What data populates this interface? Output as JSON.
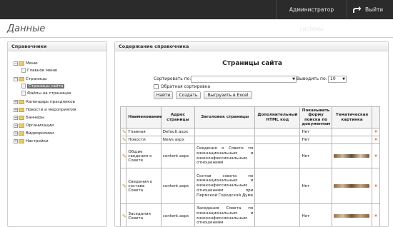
{
  "header": {
    "user_label": "Администратор системы",
    "logout_label": "Выйти"
  },
  "page": {
    "title": "Данные"
  },
  "left_panel": {
    "title": "Справочники",
    "tree": [
      {
        "label": "Меню",
        "expander": "−",
        "icon": "folder-icon",
        "level": 0
      },
      {
        "label": "Главное меню",
        "expander": "",
        "icon": "page-icon",
        "level": 1
      },
      {
        "label": "Страницы",
        "expander": "−",
        "icon": "folder-icon",
        "level": 0
      },
      {
        "label": "Страницы сайта",
        "expander": "",
        "icon": "page-icon",
        "level": 1,
        "selected": true
      },
      {
        "label": "Файлы на страницах",
        "expander": "",
        "icon": "page-icon",
        "level": 1
      },
      {
        "label": "Календарь праздников",
        "expander": "+",
        "icon": "folder-icon",
        "level": 0
      },
      {
        "label": "Новости и мероприятия",
        "expander": "+",
        "icon": "folder-icon",
        "level": 0
      },
      {
        "label": "Баннеры",
        "expander": "+",
        "icon": "folder-icon",
        "level": 0
      },
      {
        "label": "Организации",
        "expander": "+",
        "icon": "folder-icon",
        "level": 0
      },
      {
        "label": "Видеоролики",
        "expander": "+",
        "icon": "folder-icon",
        "level": 0
      },
      {
        "label": "Настройки",
        "expander": "+",
        "icon": "folder-icon",
        "level": 0
      }
    ]
  },
  "right_panel": {
    "title": "Содержание справочника",
    "content_title": "Страницы сайта",
    "sort_label": "Сортировать по:",
    "sort_value": "",
    "show_label": "Выводить по:",
    "show_value": "10",
    "reverse_sort_label": "Обратная сортировка",
    "buttons": {
      "find": "Найти",
      "create": "Создать",
      "export": "Выгрузить в Excel"
    },
    "columns": [
      "",
      "Наименование",
      "Адрес страницы",
      "Заголовок страницы",
      "Дополнительный HTML код",
      "Показывать форму поиска по документам",
      "Тематическая картинка",
      ""
    ],
    "rows": [
      {
        "name": "Главная",
        "address": "Default.aspx",
        "heading": "",
        "html": "",
        "search": "Нет",
        "picture": ""
      },
      {
        "name": "Новости",
        "address": "News.aspx",
        "heading": "",
        "html": "",
        "search": "Нет",
        "picture": ""
      },
      {
        "name": "Общие сведения о Совете",
        "address": "content.aspx",
        "heading": "Сведения о Совете по межнациональным и межконфессиональным отношениям",
        "html": "",
        "search": "Нет",
        "picture": "thumbnail"
      },
      {
        "name": "Сведения о составе Совета",
        "address": "content.aspx",
        "heading": "Состав совета по межнациональным и межконфессиональным отношениям при Пермской Городской Думе",
        "html": "",
        "search": "Нет",
        "picture": "thumbnail"
      },
      {
        "name": "Заседания Совета",
        "address": "content.aspx",
        "heading": "Заседания Совета по межнациональным и межконфессиональным отношениям",
        "html": "",
        "search": "Нет",
        "picture": "thumbnail"
      }
    ]
  }
}
